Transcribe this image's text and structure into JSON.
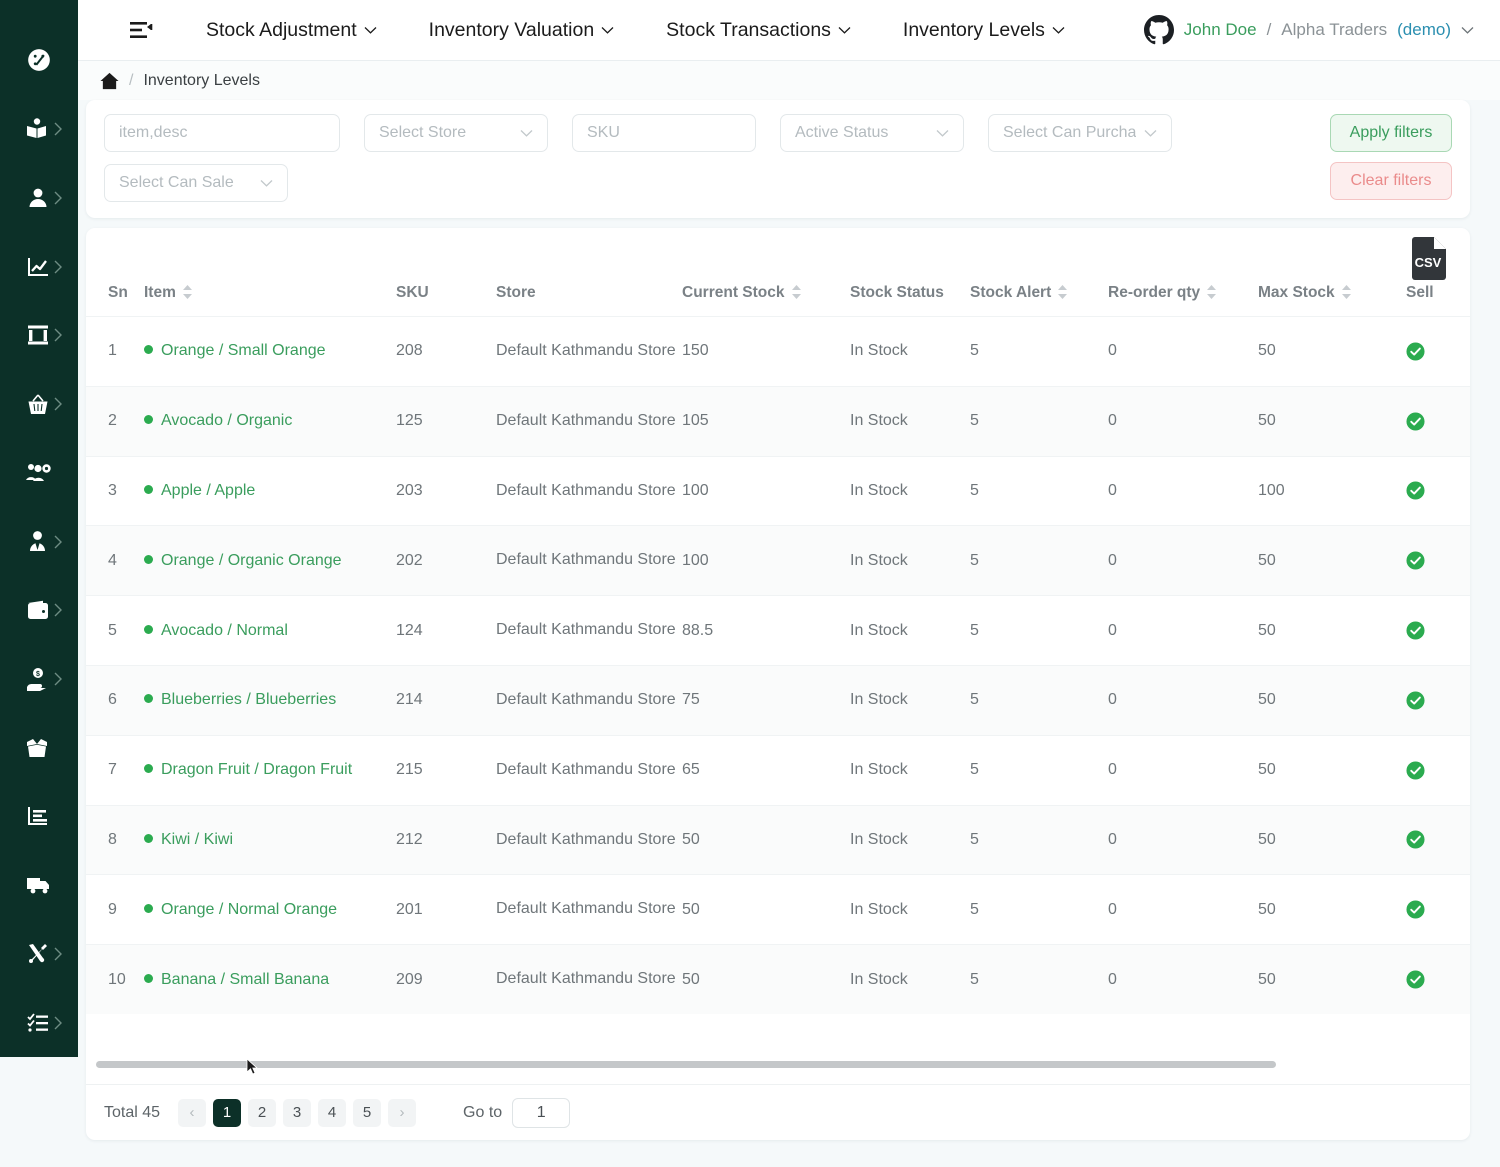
{
  "sidebar": {
    "items": [
      {
        "icon": "gauge-dashboard-icon",
        "name": "dashboard",
        "expandable": false
      },
      {
        "icon": "book-user-icon",
        "name": "contacts",
        "expandable": true
      },
      {
        "icon": "user-icon",
        "name": "customers",
        "expandable": true
      },
      {
        "icon": "chart-line-icon",
        "name": "analytics",
        "expandable": true
      },
      {
        "icon": "bank-icon",
        "name": "banking",
        "expandable": true
      },
      {
        "icon": "basket-icon",
        "name": "sales",
        "expandable": true
      },
      {
        "icon": "users-gear-icon",
        "name": "user-management",
        "expandable": false
      },
      {
        "icon": "user-tie-icon",
        "name": "employees",
        "expandable": true
      },
      {
        "icon": "wallet-icon",
        "name": "wallet",
        "expandable": true
      },
      {
        "icon": "hand-holding-dollar-icon",
        "name": "payments",
        "expandable": true
      },
      {
        "icon": "box-open-icon",
        "name": "inventory",
        "expandable": true
      },
      {
        "icon": "chart-bar-icon",
        "name": "reports",
        "expandable": false
      },
      {
        "icon": "truck-icon",
        "name": "shipping",
        "expandable": false
      },
      {
        "icon": "tools-icon",
        "name": "settings",
        "expandable": true
      },
      {
        "icon": "list-check-icon",
        "name": "tasks",
        "expandable": true
      }
    ]
  },
  "topbar": {
    "menu_toggle": "bars-staggered-icon",
    "nav": [
      {
        "label": "Stock Adjustment"
      },
      {
        "label": "Inventory Valuation"
      },
      {
        "label": "Stock Transactions"
      },
      {
        "label": "Inventory Levels"
      }
    ],
    "user": {
      "avatar_icon": "github-octocat-icon",
      "name": "John Doe",
      "separator": "/",
      "org": "Alpha Traders",
      "env": "(demo)"
    }
  },
  "breadcrumb": {
    "home_icon": "home-icon",
    "separator": "/",
    "current": "Inventory Levels"
  },
  "filters": {
    "item": {
      "placeholder": "item,desc",
      "value": ""
    },
    "store": {
      "placeholder": "Select Store",
      "value": ""
    },
    "sku": {
      "placeholder": "SKU",
      "value": ""
    },
    "active_status": {
      "placeholder": "Active Status",
      "value": ""
    },
    "can_purchase": {
      "placeholder": "Select Can Purcha",
      "value": ""
    },
    "can_sale": {
      "placeholder": "Select Can Sale",
      "value": ""
    },
    "apply_label": "Apply filters",
    "clear_label": "Clear filters"
  },
  "table": {
    "export_icon_label": "CSV",
    "columns": [
      {
        "label": "Sn",
        "sortable": false
      },
      {
        "label": "Item",
        "sortable": true
      },
      {
        "label": "SKU",
        "sortable": false
      },
      {
        "label": "Store",
        "sortable": false
      },
      {
        "label": "Current Stock",
        "sortable": true
      },
      {
        "label": "Stock Status",
        "sortable": false
      },
      {
        "label": "Stock Alert",
        "sortable": true
      },
      {
        "label": "Re-order qty",
        "sortable": true
      },
      {
        "label": "Max Stock",
        "sortable": true
      },
      {
        "label": "Sell",
        "sortable": false
      }
    ],
    "rows": [
      {
        "sn": "1",
        "item": "Orange / Small Orange",
        "sku": "208",
        "store": "Default Kathmandu Store",
        "current_stock": "150",
        "stock_status": "In Stock",
        "stock_alert": "5",
        "reorder_qty": "0",
        "max_stock": "50",
        "sell": true
      },
      {
        "sn": "2",
        "item": "Avocado / Organic",
        "sku": "125",
        "store": "Default Kathmandu Store",
        "current_stock": "105",
        "stock_status": "In Stock",
        "stock_alert": "5",
        "reorder_qty": "0",
        "max_stock": "50",
        "sell": true
      },
      {
        "sn": "3",
        "item": "Apple / Apple",
        "sku": "203",
        "store": "Default Kathmandu Store",
        "current_stock": "100",
        "stock_status": "In Stock",
        "stock_alert": "5",
        "reorder_qty": "0",
        "max_stock": "100",
        "sell": true
      },
      {
        "sn": "4",
        "item": "Orange / Organic Orange",
        "sku": "202",
        "store": "Default Kathmandu Store",
        "current_stock": "100",
        "stock_status": "In Stock",
        "stock_alert": "5",
        "reorder_qty": "0",
        "max_stock": "50",
        "sell": true
      },
      {
        "sn": "5",
        "item": "Avocado / Normal",
        "sku": "124",
        "store": "Default Kathmandu Store",
        "current_stock": "88.5",
        "stock_status": "In Stock",
        "stock_alert": "5",
        "reorder_qty": "0",
        "max_stock": "50",
        "sell": true
      },
      {
        "sn": "6",
        "item": "Blueberries / Blueberries",
        "sku": "214",
        "store": "Default Kathmandu Store",
        "current_stock": "75",
        "stock_status": "In Stock",
        "stock_alert": "5",
        "reorder_qty": "0",
        "max_stock": "50",
        "sell": true
      },
      {
        "sn": "7",
        "item": "Dragon Fruit / Dragon Fruit",
        "sku": "215",
        "store": "Default Kathmandu Store",
        "current_stock": "65",
        "stock_status": "In Stock",
        "stock_alert": "5",
        "reorder_qty": "0",
        "max_stock": "50",
        "sell": true
      },
      {
        "sn": "8",
        "item": "Kiwi / Kiwi",
        "sku": "212",
        "store": "Default Kathmandu Store",
        "current_stock": "50",
        "stock_status": "In Stock",
        "stock_alert": "5",
        "reorder_qty": "0",
        "max_stock": "50",
        "sell": true
      },
      {
        "sn": "9",
        "item": "Orange / Normal Orange",
        "sku": "201",
        "store": "Default Kathmandu Store",
        "current_stock": "50",
        "stock_status": "In Stock",
        "stock_alert": "5",
        "reorder_qty": "0",
        "max_stock": "50",
        "sell": true
      },
      {
        "sn": "10",
        "item": "Banana / Small Banana",
        "sku": "209",
        "store": "Default Kathmandu Store",
        "current_stock": "50",
        "stock_status": "In Stock",
        "stock_alert": "5",
        "reorder_qty": "0",
        "max_stock": "50",
        "sell": true
      }
    ]
  },
  "pagination": {
    "total_label": "Total 45",
    "prev": "‹",
    "next": "›",
    "pages": [
      "1",
      "2",
      "3",
      "4",
      "5"
    ],
    "active_page": "1",
    "goto_label": "Go to",
    "goto_value": "1"
  },
  "colors": {
    "sidebar_bg": "#0c3028",
    "brand_green": "#3a9d5d",
    "status_dot": "#2bab4f",
    "apply_green": "#3a9d5d",
    "clear_red": "#ea8b8b",
    "demo_blue": "#2b8fb0",
    "page_bg": "#f5f9fa"
  }
}
